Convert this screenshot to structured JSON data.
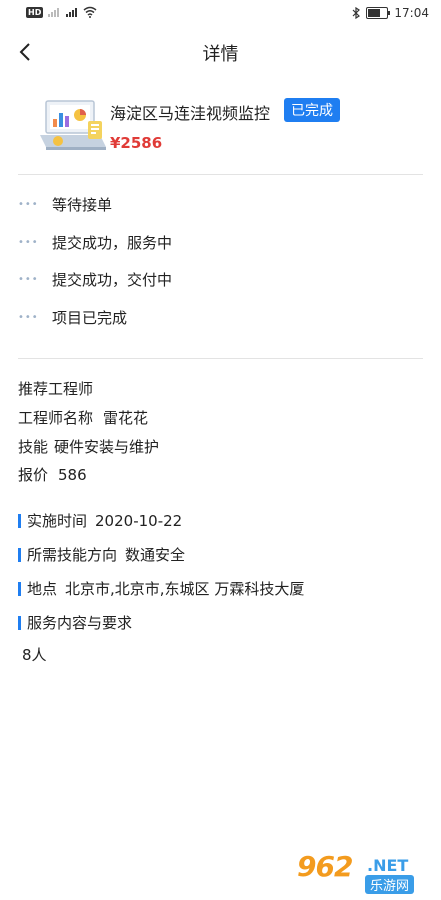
{
  "status_bar": {
    "hd_label": "HD",
    "time": "17:04",
    "battery_level": 0.7
  },
  "header": {
    "title": "详情",
    "back_icon": "chevron-left-icon"
  },
  "order": {
    "title": "海淀区马连洼视频监控",
    "status": "已完成",
    "price": "¥2586",
    "image_icon": "laptop-analytics-icon"
  },
  "progress": {
    "items": [
      {
        "label": "等待接单"
      },
      {
        "label": "提交成功，服务中"
      },
      {
        "label": "提交成功，交付中"
      },
      {
        "label": "项目已完成"
      }
    ]
  },
  "engineer": {
    "heading": "推荐工程师",
    "name_label": "工程师名称",
    "name_value": "雷花花",
    "skill_label": "技能",
    "skill_value": "硬件安装与维护",
    "quote_label": "报价",
    "quote_value": "586"
  },
  "details": {
    "time_label": "实施时间",
    "time_value": "2020-10-22",
    "direction_label": "所需技能方向",
    "direction_value": "数通安全",
    "location_label": "地点",
    "location_value": "北京市,北京市,东城区 万霖科技大厦",
    "content_label": "服务内容与要求",
    "content_value": "8人"
  },
  "watermark": {
    "number": "962",
    "net": ".NET",
    "sub": "乐游网"
  },
  "colors": {
    "accent": "#1f7ef1",
    "price": "#e03b37",
    "divider": "#e3e3e3"
  }
}
